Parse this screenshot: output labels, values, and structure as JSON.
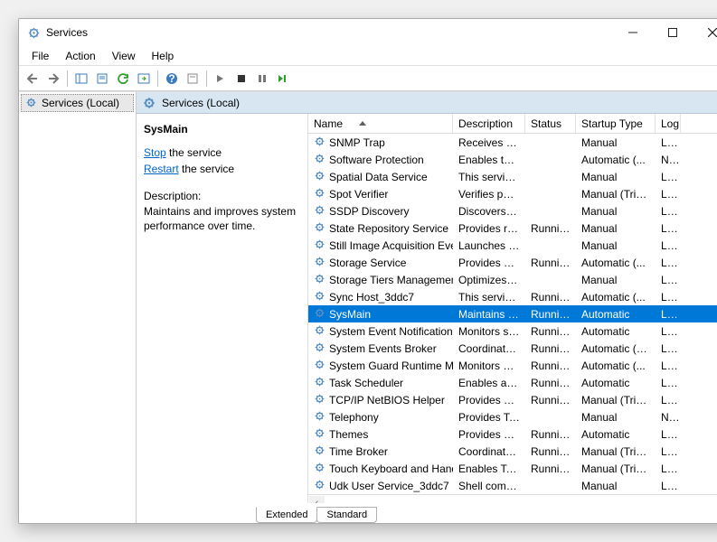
{
  "window": {
    "title": "Services"
  },
  "menu": {
    "file": "File",
    "action": "Action",
    "view": "View",
    "help": "Help"
  },
  "tree": {
    "root": "Services (Local)"
  },
  "pane": {
    "header": "Services (Local)"
  },
  "selected": {
    "name": "SysMain",
    "stop_link": "Stop",
    "stop_suffix": " the service",
    "restart_link": "Restart",
    "restart_suffix": " the service",
    "desc_label": "Description:",
    "desc_text": "Maintains and improves system performance over time."
  },
  "columns": {
    "name": "Name",
    "desc": "Description",
    "status": "Status",
    "startup": "Startup Type",
    "log": "Log"
  },
  "services": [
    {
      "name": "SNMP Trap",
      "desc": "Receives tra...",
      "status": "",
      "startup": "Manual",
      "log": "Loca"
    },
    {
      "name": "Software Protection",
      "desc": "Enables the ...",
      "status": "",
      "startup": "Automatic (...",
      "log": "Netv"
    },
    {
      "name": "Spatial Data Service",
      "desc": "This service ...",
      "status": "",
      "startup": "Manual",
      "log": "Loca"
    },
    {
      "name": "Spot Verifier",
      "desc": "Verifies pote...",
      "status": "",
      "startup": "Manual (Trig...",
      "log": "Loca"
    },
    {
      "name": "SSDP Discovery",
      "desc": "Discovers n...",
      "status": "",
      "startup": "Manual",
      "log": "Loca"
    },
    {
      "name": "State Repository Service",
      "desc": "Provides re...",
      "status": "Running",
      "startup": "Manual",
      "log": "Loca"
    },
    {
      "name": "Still Image Acquisition Events",
      "desc": "Launches a...",
      "status": "",
      "startup": "Manual",
      "log": "Loca"
    },
    {
      "name": "Storage Service",
      "desc": "Provides en...",
      "status": "Running",
      "startup": "Automatic (...",
      "log": "Loca"
    },
    {
      "name": "Storage Tiers Management",
      "desc": "Optimizes t...",
      "status": "",
      "startup": "Manual",
      "log": "Loca"
    },
    {
      "name": "Sync Host_3ddc7",
      "desc": "This service ...",
      "status": "Running",
      "startup": "Automatic (...",
      "log": "Loca"
    },
    {
      "name": "SysMain",
      "desc": "Maintains a...",
      "status": "Running",
      "startup": "Automatic",
      "log": "Loca",
      "selected": true
    },
    {
      "name": "System Event Notification S...",
      "desc": "Monitors sy...",
      "status": "Running",
      "startup": "Automatic",
      "log": "Loca"
    },
    {
      "name": "System Events Broker",
      "desc": "Coordinates...",
      "status": "Running",
      "startup": "Automatic (T...",
      "log": "Loca"
    },
    {
      "name": "System Guard Runtime Mo...",
      "desc": "Monitors an...",
      "status": "Running",
      "startup": "Automatic (...",
      "log": "Loca"
    },
    {
      "name": "Task Scheduler",
      "desc": "Enables a us...",
      "status": "Running",
      "startup": "Automatic",
      "log": "Loca"
    },
    {
      "name": "TCP/IP NetBIOS Helper",
      "desc": "Provides su...",
      "status": "Running",
      "startup": "Manual (Trig...",
      "log": "Loca"
    },
    {
      "name": "Telephony",
      "desc": "Provides Tel...",
      "status": "",
      "startup": "Manual",
      "log": "Netv"
    },
    {
      "name": "Themes",
      "desc": "Provides us...",
      "status": "Running",
      "startup": "Automatic",
      "log": "Loca"
    },
    {
      "name": "Time Broker",
      "desc": "Coordinates...",
      "status": "Running",
      "startup": "Manual (Trig...",
      "log": "Loca"
    },
    {
      "name": "Touch Keyboard and Hand...",
      "desc": "Enables Tou...",
      "status": "Running",
      "startup": "Manual (Trig...",
      "log": "Loca"
    },
    {
      "name": "Udk User Service_3ddc7",
      "desc": "Shell comp...",
      "status": "",
      "startup": "Manual",
      "log": "Loca"
    }
  ],
  "tabs": {
    "extended": "Extended",
    "standard": "Standard"
  }
}
